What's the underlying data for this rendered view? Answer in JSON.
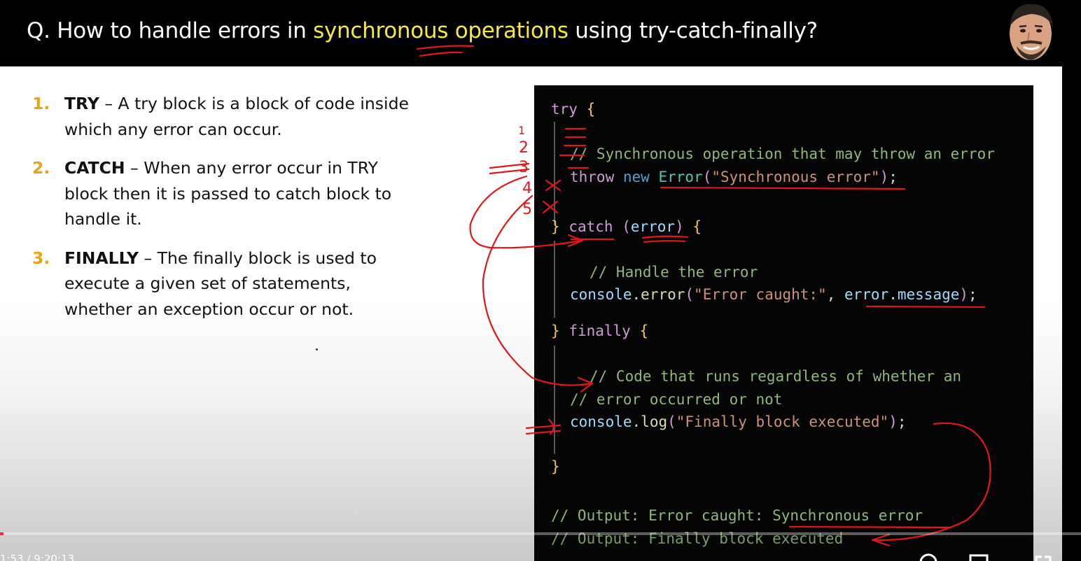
{
  "title": {
    "prefix": "Q. How to handle errors in ",
    "highlight": "synchronous operations",
    "suffix": " using try-catch-finally?"
  },
  "colors": {
    "title_highlight": "#f7ea3c",
    "list_number": "#e8a317",
    "annotation": "#e01818",
    "progress": "#f0284a",
    "code_background": "#050505"
  },
  "list": [
    {
      "num": "1.",
      "term": "TRY",
      "text": " – A try block is a block of code inside which any error can occur."
    },
    {
      "num": "2.",
      "term": "CATCH",
      "text": " – When any error occur in TRY block then it is passed to catch block to handle it."
    },
    {
      "num": "3.",
      "term": "FINALLY",
      "text": " – The finally block is used to execute a given set of statements, whether an exception occur or not."
    }
  ],
  "code": {
    "try_kw": "try",
    "open_brace": "{",
    "close_brace": "}",
    "comment_sync": "// Synchronous operation that may throw an error",
    "throw_kw": "throw",
    "new_kw": "new",
    "error_class": "Error",
    "error_string": "\"Synchronous error\"",
    "catch_kw": "catch",
    "catch_param": "error",
    "comment_handle": "// Handle the error",
    "console_obj": "console",
    "error_fn": "error",
    "caught_string": "\"Error caught:\"",
    "error_obj": "error",
    "message_prop": "message",
    "finally_kw": "finally",
    "comment_runs_1": "// Code that runs regardless of whether an",
    "comment_runs_2": "// error occurred or not",
    "log_fn": "log",
    "finally_string": "\"Finally block executed\"",
    "output_1": "// Output: Error caught: Synchronous error",
    "output_2": "// Output: Finally block executed"
  },
  "player": {
    "time": "1:53 / 9:20:13",
    "progress_fraction": 0.0034
  },
  "annotations": {
    "step_numbers": [
      "1",
      "2",
      "3",
      "4",
      "5"
    ],
    "cross_marks": [
      "x",
      "x"
    ]
  },
  "icons": [
    "avatar-presenter",
    "settings-icon",
    "subtitles-icon",
    "miniplayer-icon"
  ]
}
